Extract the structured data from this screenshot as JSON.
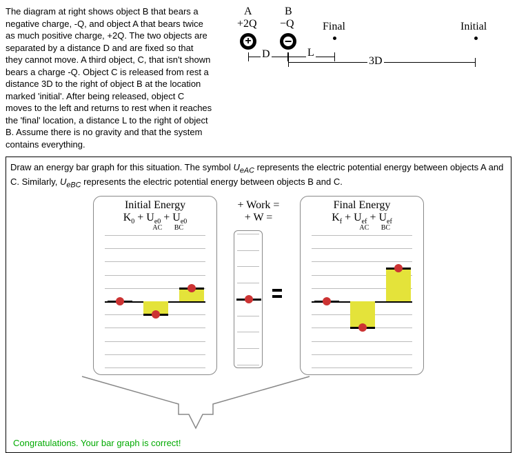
{
  "problem_text": "The diagram at right shows object B that bears a negative charge, -Q, and object A that bears twice as much positive charge, +2Q. The two objects are separated by a distance D and are fixed so that they cannot move. A third object, C, that isn't shown bears a charge -Q. Object C is released from rest a distance 3D to the right of object B at the location marked 'initial'. After being released, object C moves to the left and returns to rest when it reaches the 'final' location, a distance L to the right of object B. Assume there is no gravity and that the system contains everything.",
  "objA": {
    "label": "A",
    "charge": "+2Q"
  },
  "objB": {
    "label": "B",
    "charge": "−Q"
  },
  "final_label": "Final",
  "initial_label": "Initial",
  "dim_D": "D",
  "dim_L": "L",
  "dim_3D": "3D",
  "question": "Draw an energy bar graph for this situation. The symbol UeAC represents the electric potential energy between objects A and C. Similarly, UeBC represents the electric potential energy between objects B and C.",
  "initial_title": "Initial Energy",
  "final_title": "Final Energy",
  "work_header1": "+   Work   =",
  "work_header2": "+     W     =",
  "terms_initial": "K₀ + Ue₀ + Ue₀",
  "terms_initial_sub": "        AC     BC",
  "terms_final": "Kf + Uef + Uef",
  "terms_final_sub": "        AC     BC",
  "congrats": "Congratulations. Your bar graph is correct!",
  "chart_data": {
    "type": "bar",
    "note": "Qualitative energy bar chart; values are in grid units relative to zero line",
    "initial": {
      "K0": 0,
      "Ue0_AC": -1,
      "Ue0_BC": 1
    },
    "work": {
      "W": 0
    },
    "final": {
      "Kf": 0,
      "Uef_AC": -2,
      "Uef_BC": 2.5
    }
  }
}
